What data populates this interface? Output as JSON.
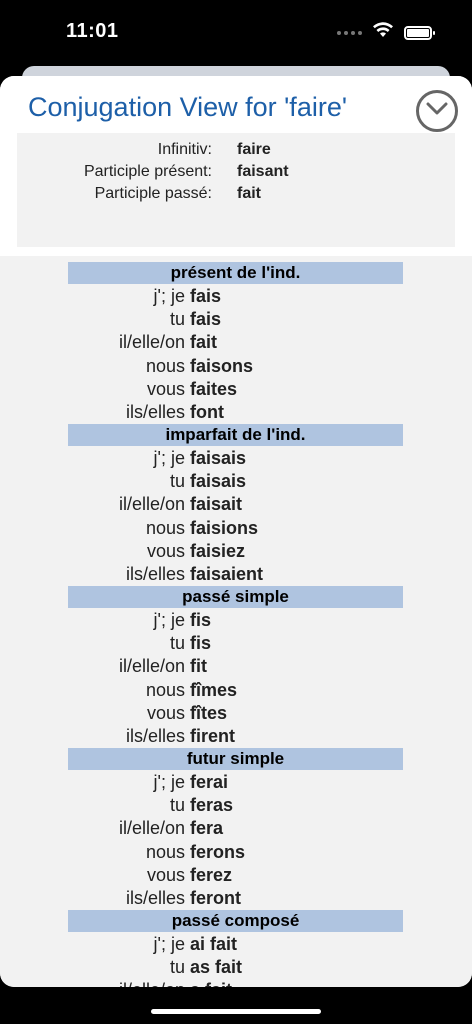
{
  "status": {
    "time": "11:01"
  },
  "sheet": {
    "title": "Conjugation View for 'faire'"
  },
  "info": [
    {
      "label": "Infinitiv:",
      "value": "faire"
    },
    {
      "label": "Participle présent:",
      "value": "faisant"
    },
    {
      "label": "Participle passé:",
      "value": "fait"
    }
  ],
  "tenses": [
    {
      "name": "présent de l'ind.",
      "rows": [
        {
          "pronoun": "j'; je",
          "form": "fais"
        },
        {
          "pronoun": "tu",
          "form": "fais"
        },
        {
          "pronoun": "il/elle/on",
          "form": "fait"
        },
        {
          "pronoun": "nous",
          "form": "faisons"
        },
        {
          "pronoun": "vous",
          "form": "faites"
        },
        {
          "pronoun": "ils/elles",
          "form": "font"
        }
      ]
    },
    {
      "name": "imparfait de l'ind.",
      "rows": [
        {
          "pronoun": "j'; je",
          "form": "faisais"
        },
        {
          "pronoun": "tu",
          "form": "faisais"
        },
        {
          "pronoun": "il/elle/on",
          "form": "faisait"
        },
        {
          "pronoun": "nous",
          "form": "faisions"
        },
        {
          "pronoun": "vous",
          "form": "faisiez"
        },
        {
          "pronoun": "ils/elles",
          "form": "faisaient"
        }
      ]
    },
    {
      "name": "passé simple",
      "rows": [
        {
          "pronoun": "j'; je",
          "form": "fis"
        },
        {
          "pronoun": "tu",
          "form": "fis"
        },
        {
          "pronoun": "il/elle/on",
          "form": "fit"
        },
        {
          "pronoun": "nous",
          "form": "fîmes"
        },
        {
          "pronoun": "vous",
          "form": "fîtes"
        },
        {
          "pronoun": "ils/elles",
          "form": "firent"
        }
      ]
    },
    {
      "name": "futur simple",
      "rows": [
        {
          "pronoun": "j'; je",
          "form": "ferai"
        },
        {
          "pronoun": "tu",
          "form": "feras"
        },
        {
          "pronoun": "il/elle/on",
          "form": "fera"
        },
        {
          "pronoun": "nous",
          "form": "ferons"
        },
        {
          "pronoun": "vous",
          "form": "ferez"
        },
        {
          "pronoun": "ils/elles",
          "form": "feront"
        }
      ]
    },
    {
      "name": "passé composé",
      "rows": [
        {
          "pronoun": "j'; je",
          "form": "ai fait"
        },
        {
          "pronoun": "tu",
          "form": "as fait"
        },
        {
          "pronoun": "il/elle/on",
          "form": "a fait"
        }
      ]
    }
  ]
}
